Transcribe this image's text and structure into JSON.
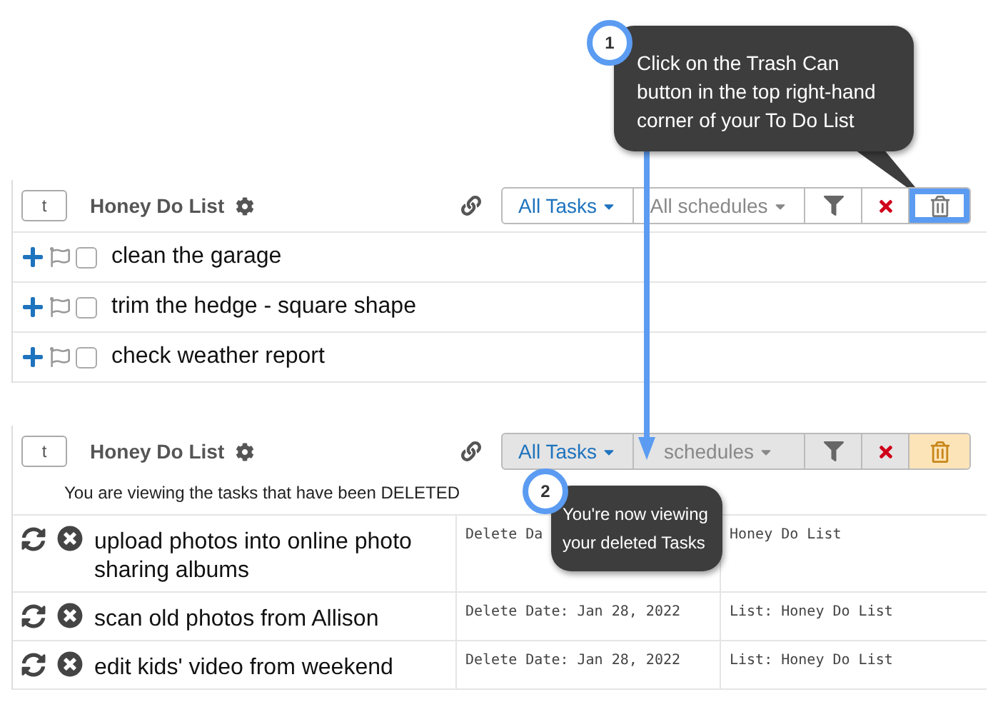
{
  "callouts": [
    {
      "number": "1",
      "text": "Click on the Trash Can\nbutton in the top right-hand\ncorner of your To Do List"
    },
    {
      "number": "2",
      "text": "You're now viewing\nyour deleted Tasks"
    }
  ],
  "lists": [
    {
      "kind": "active",
      "up_button": "t",
      "title": "Honey Do List",
      "toolbar": {
        "tasks_filter": "All Tasks",
        "schedule_filter": "All schedules",
        "trash_selected": false,
        "trash_highlighted": true
      },
      "tasks": [
        {
          "title": "clean the garage",
          "checked": false
        },
        {
          "title": "trim the hedge - square shape",
          "checked": false
        },
        {
          "title": "check weather report",
          "checked": false
        }
      ]
    },
    {
      "kind": "deleted",
      "up_button": "t",
      "title": "Honey Do List",
      "notice": "You are viewing the tasks that have been DELETED",
      "toolbar": {
        "tasks_filter": "All Tasks",
        "schedule_filter": "schedules",
        "trash_selected": true,
        "trash_highlighted": false
      },
      "tasks": [
        {
          "title": "upload photos into online photo sharing albums",
          "delete_date": "Delete Da",
          "list": "Honey Do List"
        },
        {
          "title": "scan old photos from Allison",
          "delete_date": "Delete Date: Jan 28, 2022",
          "list": "List: Honey Do List"
        },
        {
          "title": "edit kids' video from weekend",
          "delete_date": "Delete Date: Jan 28, 2022",
          "list": "List: Honey Do List"
        }
      ]
    }
  ]
}
